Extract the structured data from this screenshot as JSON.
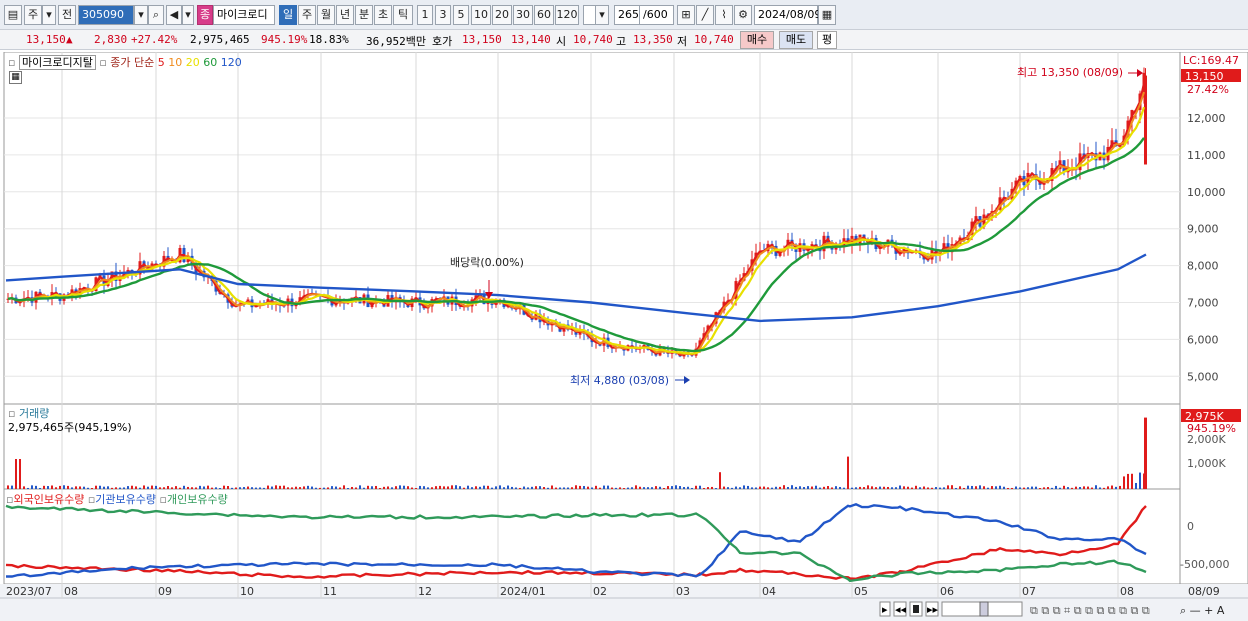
{
  "toolbar": {
    "market": "주",
    "prev_label": "전",
    "code": "305090",
    "stock_name": "마이크로디",
    "badge": "종",
    "period_tabs": [
      "일",
      "주",
      "월",
      "년",
      "분",
      "초",
      "틱"
    ],
    "active_period": "일",
    "intervals": [
      "1",
      "3",
      "5",
      "10",
      "20",
      "30",
      "60",
      "120"
    ],
    "count": "265",
    "count_max": "/600",
    "date": "2024/08/09"
  },
  "quote": {
    "price": "13,150",
    "change": "2,830",
    "change_pct": "+27.42%",
    "volume": "2,975,465",
    "vol_ratio": "945.19%",
    "turnover": "18.83%",
    "amount": "36,952백만",
    "ask_label": "호가",
    "ask": "13,150",
    "bid": "13,140",
    "open_label": "시",
    "open": "10,740",
    "high_label": "고",
    "high": "13,350",
    "low_label": "저",
    "low": "10,740",
    "buy_btn": "매수",
    "sell_btn": "매도",
    "eval_btn": "평"
  },
  "legend": {
    "price_title": "마이크로디지탈",
    "ma_title": "종가 단순",
    "ma_periods": [
      "5",
      "10",
      "20",
      "60",
      "120"
    ],
    "ma_colors": [
      "#e01b1b",
      "#f08c1e",
      "#e8e000",
      "#1f9a3a",
      "#2156c8"
    ],
    "volume_title": "거래량",
    "volume_value": "2,975,465주(945,19%)",
    "holding_titles": [
      "외국인보유수량",
      "기관보유수량",
      "개인보유수량"
    ],
    "holding_colors": [
      "#e01b1b",
      "#2156c8",
      "#2f9a5a"
    ]
  },
  "annotations": {
    "high": "최고 13,350 (08/09)",
    "low": "최저 4,880 (03/08)",
    "dividend": "배당락(0.00%)"
  },
  "axis": {
    "price_ticks": [
      "12,000",
      "11,000",
      "10,000",
      "9,000",
      "8,000",
      "7,000",
      "6,000",
      "5,000"
    ],
    "lc": "LC:169.47",
    "current_price": "13,150",
    "current_pct": "27.42%",
    "volume_ticks": [
      "2,000K",
      "1,000K"
    ],
    "volume_current": "2,975K",
    "volume_pct": "945.19%",
    "holding_ticks": [
      "0",
      "-500,000"
    ],
    "dates": [
      "2023/07",
      "08",
      "09",
      "10",
      "11",
      "12",
      "2024/01",
      "02",
      "03",
      "04",
      "05",
      "06",
      "07",
      "08",
      "08/09"
    ]
  },
  "chart_data": {
    "type": "candlestick",
    "x": [
      "2023/07",
      "08",
      "09",
      "10",
      "11",
      "12",
      "2024/01",
      "02",
      "03",
      "04",
      "05",
      "06",
      "07",
      "08",
      "08/09"
    ],
    "close_approx": [
      7100,
      7200,
      8300,
      6900,
      7100,
      7000,
      7100,
      6000,
      5500,
      8400,
      8700,
      8300,
      10200,
      11200,
      13150
    ],
    "ma120_approx": [
      7600,
      7700,
      7900,
      7500,
      7400,
      7300,
      7200,
      7000,
      6700,
      6500,
      6600,
      6900,
      7300,
      7900,
      8300
    ],
    "high": 13350,
    "low": 4880,
    "volume_last": 2975465,
    "ylim": [
      4500,
      13600
    ]
  }
}
